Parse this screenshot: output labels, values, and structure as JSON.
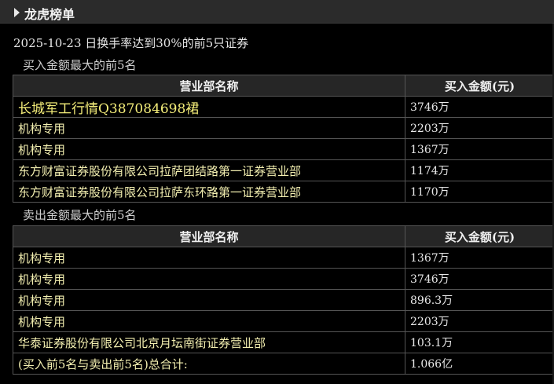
{
  "panel": {
    "title": "龙虎榜单"
  },
  "date_line": "2025-10-23 日换手率达到30%的前5只证券",
  "buy_section": {
    "title": "买入金额最大的前5名",
    "headers": [
      "营业部名称",
      "买入金额(元)"
    ],
    "rows": [
      {
        "name": "长城军工行情Q387084698裙",
        "amount": "3746万"
      },
      {
        "name": "机构专用",
        "amount": "2203万"
      },
      {
        "name": "机构专用",
        "amount": "1367万"
      },
      {
        "name": "东方财富证券股份有限公司拉萨团结路第一证券营业部",
        "amount": "1174万"
      },
      {
        "name": "东方财富证券股份有限公司拉萨东环路第一证券营业部",
        "amount": "1170万"
      }
    ]
  },
  "sell_section": {
    "title": "卖出金额最大的前5名",
    "headers": [
      "营业部名称",
      "买入金额(元)"
    ],
    "rows": [
      {
        "name": "机构专用",
        "amount": "1367万"
      },
      {
        "name": "机构专用",
        "amount": "3746万"
      },
      {
        "name": "机构专用",
        "amount": "896.3万"
      },
      {
        "name": "机构专用",
        "amount": "2203万"
      },
      {
        "name": "华泰证券股份有限公司北京月坛南街证券营业部",
        "amount": "103.1万"
      }
    ]
  },
  "total": {
    "label": "(买入前5名与卖出前5名)总合计:",
    "value": "1.066亿"
  }
}
